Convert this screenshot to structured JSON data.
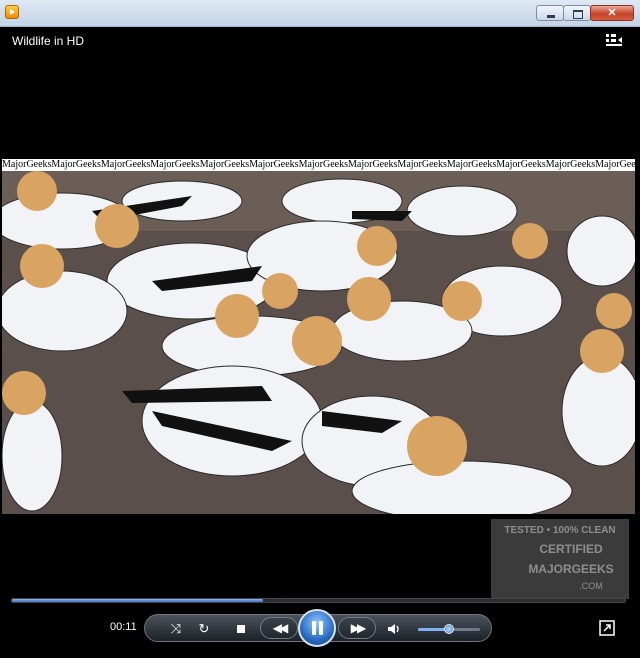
{
  "window": {
    "title": ""
  },
  "media": {
    "title": "Wildlife in HD"
  },
  "video": {
    "watermark_text": "MajorGeeksMajorGeeksMajorGeeksMajorGeeksMajorGeeksMajorGeeksMajorGeeksMajorGeeksMajorGeeksMajorGeeksMajorGeeksMajorGeeksMajorGeeks",
    "stamp_lines": [
      "TESTED • 100% CLEAN",
      "CERTIFIED",
      "MAJORGEEKS",
      ".COM"
    ]
  },
  "playback": {
    "elapsed": "00:11",
    "progress": 0.41,
    "volume": 0.5
  },
  "icons": {
    "playlist": "switch-to-library-icon",
    "shuffle": "shuffle-icon",
    "repeat": "repeat-icon",
    "stop": "stop-icon",
    "previous": "previous-icon",
    "play_pause": "pause-icon",
    "next": "next-icon",
    "mute": "speaker-icon",
    "fullscreen": "fullscreen-icon"
  },
  "colors": {
    "accent": "#3e74c0",
    "titlebar": "#c3d4e7",
    "close": "#c8432a"
  }
}
